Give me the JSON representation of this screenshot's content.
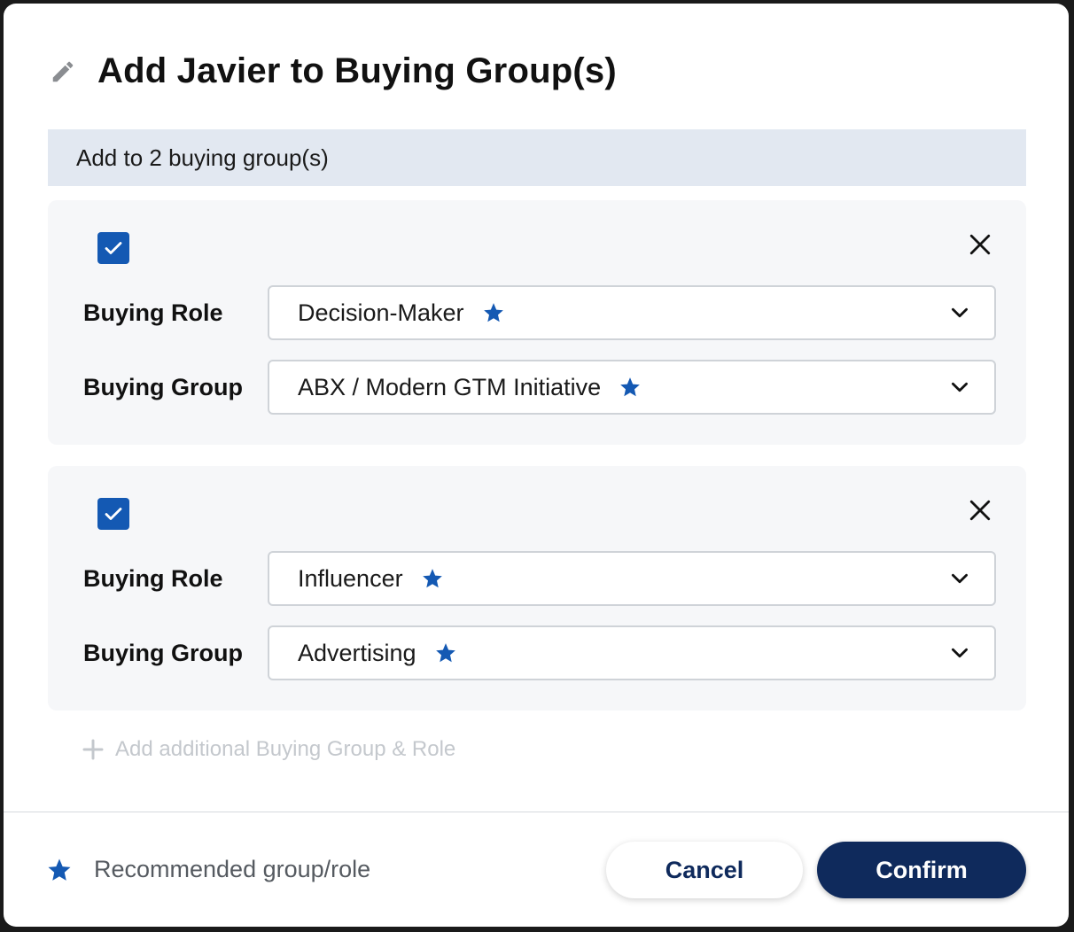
{
  "dialog": {
    "title": "Add Javier to Buying Group(s)",
    "title_icon": "pencil-icon"
  },
  "banner": {
    "text": "Add to 2 buying group(s)"
  },
  "entries": [
    {
      "checked": true,
      "role_label": "Buying Role",
      "role_value": "Decision-Maker",
      "role_recommended": true,
      "group_label": "Buying Group",
      "group_value": "ABX / Modern GTM Initiative",
      "group_recommended": true
    },
    {
      "checked": true,
      "role_label": "Buying Role",
      "role_value": "Influencer",
      "role_recommended": true,
      "group_label": "Buying Group",
      "group_value": "Advertising",
      "group_recommended": true
    }
  ],
  "add_more": {
    "label": "Add additional Buying Group & Role"
  },
  "footer": {
    "legend_text": "Recommended group/role",
    "cancel_label": "Cancel",
    "confirm_label": "Confirm"
  },
  "colors": {
    "accent": "#1459b3",
    "primary_button": "#0f2a5c",
    "banner_bg": "#e2e8f1",
    "card_bg": "#f6f7f9"
  }
}
